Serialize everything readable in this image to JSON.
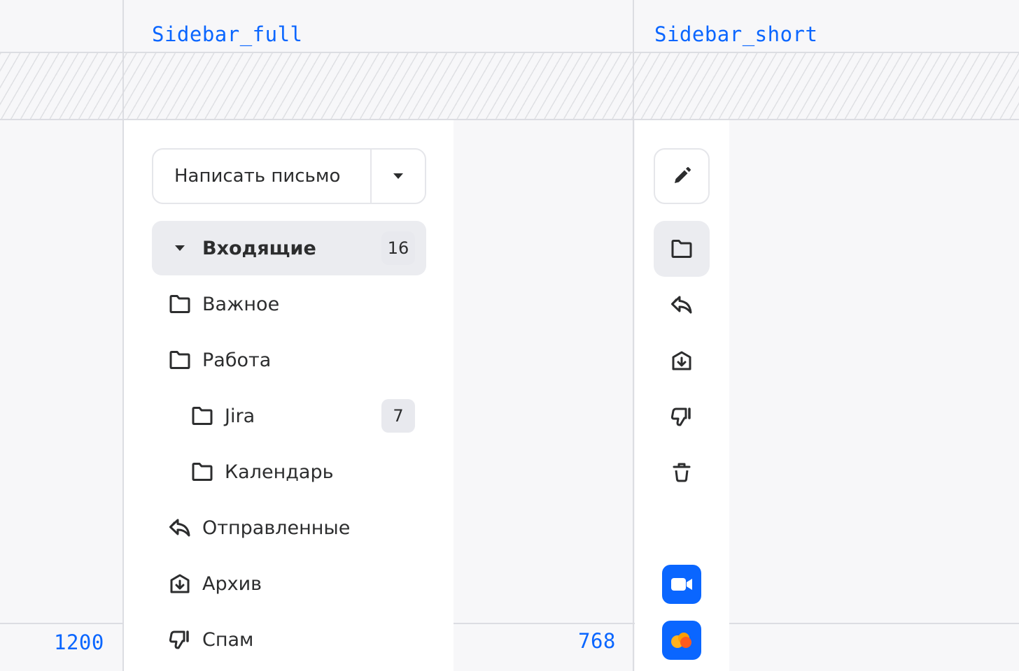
{
  "frames": {
    "full_title": "Sidebar_full",
    "short_title": "Sidebar_short",
    "breakpoint_left": "1200",
    "breakpoint_right": "768"
  },
  "colors": {
    "accent": "#0a66ff",
    "active_bg": "#ebecf0",
    "text": "#2c2d2e"
  },
  "compose": {
    "label": "Написать письмо",
    "dropdown_icon": "caret-down-icon"
  },
  "folders": [
    {
      "label": "Входящие",
      "icon": "caret-down-icon",
      "badge": "16",
      "active": true
    },
    {
      "label": "Важное",
      "icon": "folder-icon"
    },
    {
      "label": "Работа",
      "icon": "folder-icon"
    },
    {
      "label": "Jira",
      "icon": "folder-icon",
      "badge": "7",
      "sub": true
    },
    {
      "label": "Календарь",
      "icon": "folder-icon",
      "sub": true
    },
    {
      "label": "Отправленные",
      "icon": "sent-icon"
    },
    {
      "label": "Архив",
      "icon": "archive-icon"
    },
    {
      "label": "Спам",
      "icon": "spam-icon"
    }
  ],
  "short_icons": [
    "pencil-icon",
    "folder-icon",
    "sent-icon",
    "archive-icon",
    "spam-icon",
    "trash-icon"
  ],
  "apps": [
    "video-call-icon",
    "cloud-icon"
  ]
}
